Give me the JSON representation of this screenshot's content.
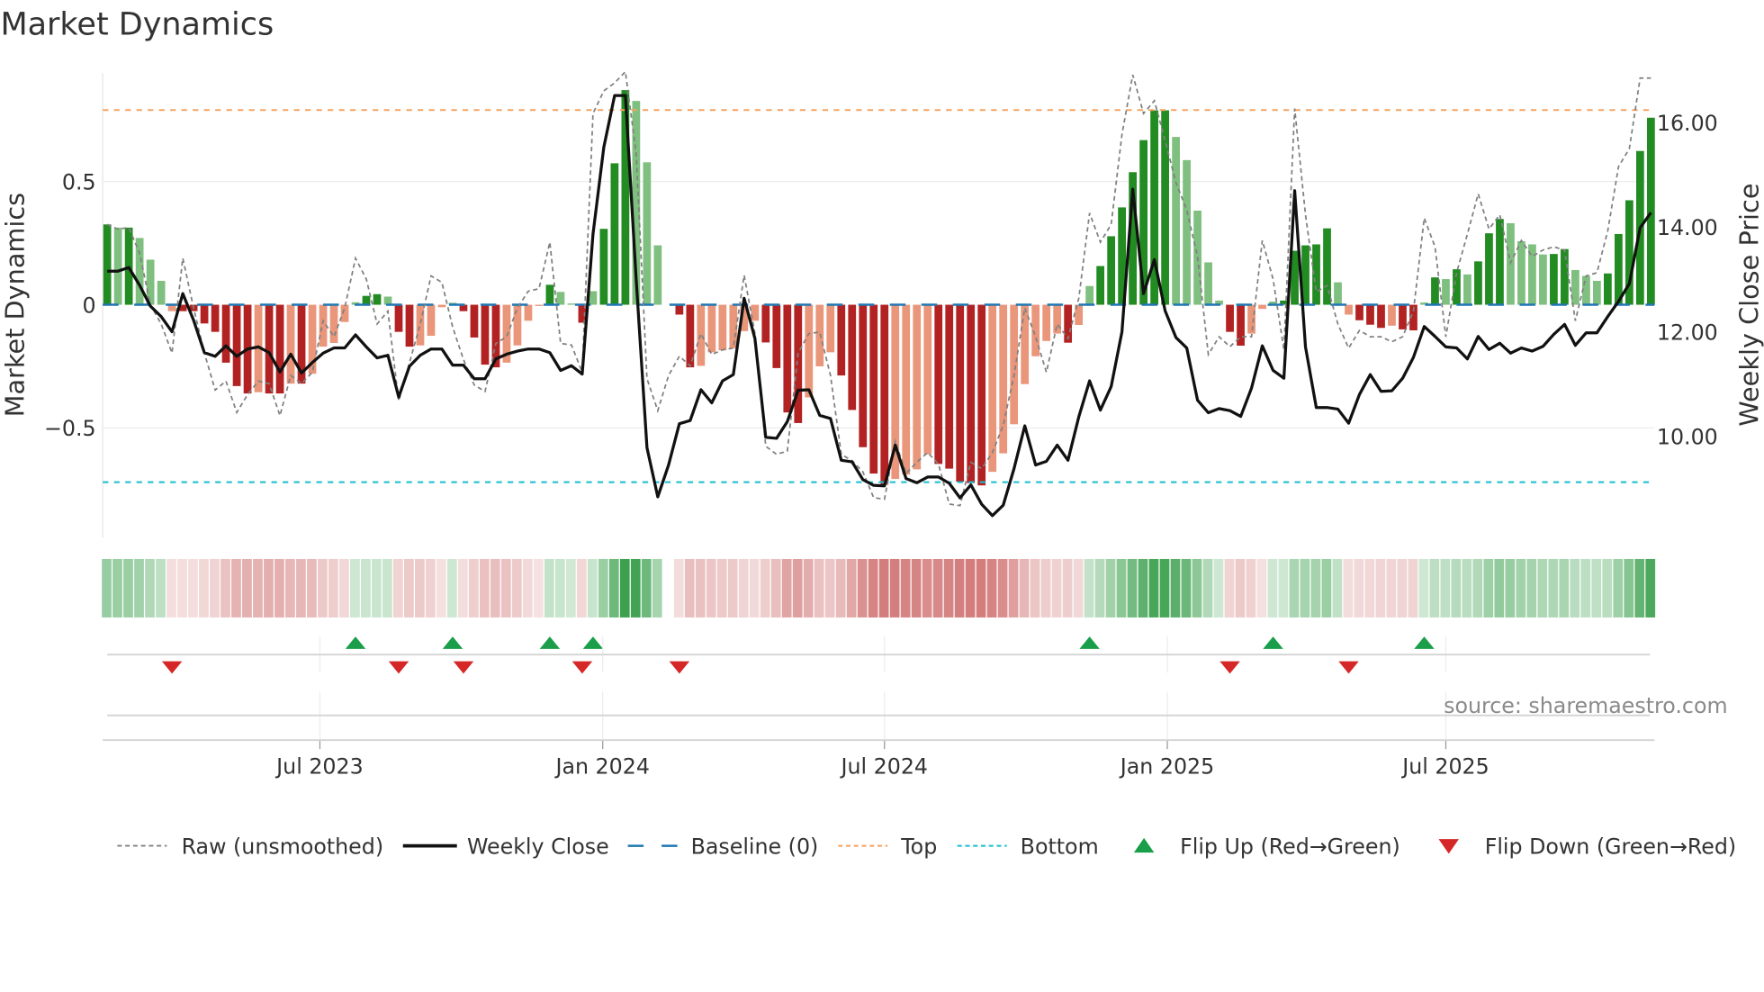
{
  "chart_data": {
    "type": "bar",
    "title": "Market Dynamics",
    "ylabel": "Market Dynamics",
    "y2label": "Weekly Close Price",
    "x_start": "2023-02-10",
    "x_frequency": "weekly",
    "ylim": [
      -0.945,
      0.94
    ],
    "y2lim": [
      8.06,
      16.95
    ],
    "yticks": [
      {
        "v": 0.5,
        "label": "0.5"
      },
      {
        "v": 0,
        "label": "0"
      },
      {
        "v": -0.5,
        "label": "−0.5"
      }
    ],
    "y2ticks": [
      {
        "v": 16,
        "label": "16.00"
      },
      {
        "v": 14,
        "label": "14.00"
      },
      {
        "v": 12,
        "label": "12.00"
      },
      {
        "v": 10,
        "label": "10.00"
      }
    ],
    "xticks": [
      {
        "week": 19.7,
        "label": "Jul 2023"
      },
      {
        "week": 45.9,
        "label": "Jan 2024"
      },
      {
        "week": 72,
        "label": "Jul 2024"
      },
      {
        "week": 98.2,
        "label": "Jan 2025"
      },
      {
        "week": 124,
        "label": "Jul 2025"
      }
    ],
    "top_level": 0.79,
    "bottom_level": -0.72,
    "baseline": 0,
    "momentum": [
      0.326,
      0.313,
      0.313,
      0.271,
      0.183,
      0.097,
      -0.026,
      -0.026,
      -0.026,
      -0.076,
      -0.11,
      -0.235,
      -0.33,
      -0.36,
      -0.355,
      -0.36,
      -0.36,
      -0.32,
      -0.32,
      -0.28,
      -0.17,
      -0.155,
      -0.07,
      0.01,
      0.036,
      0.043,
      0.033,
      -0.11,
      -0.17,
      -0.165,
      -0.126,
      -0.01,
      0.008,
      -0.026,
      -0.133,
      -0.243,
      -0.254,
      -0.235,
      -0.165,
      -0.065,
      -0.005,
      0.081,
      0.052,
      0.005,
      -0.073,
      0.055,
      0.308,
      0.574,
      0.871,
      0.827,
      0.578,
      0.241,
      null,
      -0.04,
      -0.254,
      -0.248,
      -0.193,
      -0.185,
      -0.176,
      -0.107,
      -0.065,
      -0.153,
      -0.257,
      -0.437,
      -0.48,
      -0.376,
      -0.25,
      -0.193,
      -0.287,
      -0.427,
      -0.578,
      -0.685,
      -0.73,
      -0.707,
      -0.689,
      -0.668,
      -0.607,
      -0.646,
      -0.665,
      -0.718,
      -0.724,
      -0.733,
      -0.678,
      -0.603,
      -0.485,
      -0.322,
      -0.209,
      -0.147,
      -0.117,
      -0.154,
      -0.082,
      0.076,
      0.157,
      0.278,
      0.395,
      0.538,
      0.668,
      0.789,
      0.789,
      0.681,
      0.587,
      0.382,
      0.172,
      0.017,
      -0.11,
      -0.166,
      -0.117,
      -0.017,
      0.013,
      0.017,
      0.219,
      0.241,
      0.245,
      0.31,
      0.091,
      -0.04,
      -0.063,
      -0.081,
      -0.094,
      -0.085,
      -0.1,
      -0.104,
      0.009,
      0.111,
      0.104,
      0.144,
      0.123,
      0.176,
      0.29,
      0.348,
      0.331,
      0.258,
      0.245,
      0.204,
      0.206,
      0.226,
      0.141,
      0.117,
      0.097,
      0.127,
      0.287,
      0.424,
      0.624,
      0.759
    ],
    "raw": [
      0.326,
      0.307,
      0.313,
      0.209,
      0.0,
      -0.078,
      -0.196,
      0.189,
      -0.013,
      -0.196,
      -0.346,
      -0.31,
      -0.437,
      -0.365,
      -0.31,
      -0.32,
      -0.45,
      -0.287,
      -0.32,
      -0.274,
      -0.065,
      -0.13,
      -0.013,
      0.189,
      0.104,
      -0.078,
      -0.026,
      -0.391,
      -0.235,
      -0.078,
      0.117,
      0.091,
      -0.091,
      -0.222,
      -0.326,
      -0.352,
      -0.157,
      -0.13,
      -0.013,
      0.055,
      0.065,
      0.254,
      -0.157,
      -0.163,
      -0.274,
      0.776,
      0.868,
      0.9,
      0.946,
      0.613,
      -0.3,
      -0.43,
      -0.287,
      -0.209,
      -0.248,
      -0.117,
      -0.202,
      -0.183,
      -0.176,
      0.12,
      -0.117,
      -0.574,
      -0.607,
      -0.594,
      -0.196,
      -0.117,
      -0.111,
      -0.287,
      -0.607,
      -0.633,
      -0.678,
      -0.783,
      -0.789,
      -0.554,
      -0.685,
      -0.639,
      -0.6,
      -0.646,
      -0.809,
      -0.815,
      -0.639,
      -0.665,
      -0.6,
      -0.489,
      -0.287,
      -0.013,
      -0.13,
      -0.274,
      -0.078,
      -0.137,
      0.026,
      0.372,
      0.254,
      0.326,
      0.691,
      0.933,
      0.776,
      0.828,
      0.665,
      0.496,
      0.385,
      0.196,
      -0.202,
      -0.13,
      -0.17,
      -0.13,
      -0.13,
      0.261,
      0.104,
      -0.183,
      0.796,
      0.365,
      0.052,
      0.078,
      -0.078,
      -0.176,
      -0.104,
      -0.13,
      -0.13,
      -0.15,
      -0.13,
      -0.026,
      0.352,
      0.235,
      -0.13,
      0.13,
      0.287,
      0.45,
      0.307,
      0.365,
      0.17,
      0.261,
      0.196,
      0.222,
      0.235,
      0.222,
      -0.065,
      0.117,
      0.13,
      0.3,
      0.561,
      0.633,
      0.92,
      0.92
    ],
    "weekly_close": [
      13.16,
      13.16,
      13.23,
      12.89,
      12.49,
      12.29,
      12.0,
      12.73,
      12.22,
      11.6,
      11.53,
      11.73,
      11.53,
      11.67,
      11.71,
      11.6,
      11.23,
      11.57,
      11.21,
      11.41,
      11.59,
      11.69,
      11.69,
      11.94,
      11.71,
      11.5,
      11.55,
      10.75,
      11.34,
      11.55,
      11.67,
      11.67,
      11.36,
      11.36,
      11.1,
      11.1,
      11.48,
      11.57,
      11.63,
      11.67,
      11.67,
      11.6,
      11.26,
      11.35,
      11.19,
      13.87,
      15.53,
      16.52,
      16.52,
      13.0,
      9.78,
      8.84,
      9.45,
      10.24,
      10.3,
      10.89,
      10.64,
      11.06,
      11.18,
      12.64,
      11.87,
      9.98,
      9.96,
      10.28,
      10.88,
      10.89,
      10.4,
      10.34,
      9.54,
      9.51,
      9.17,
      9.06,
      9.05,
      9.83,
      9.19,
      9.11,
      9.22,
      9.22,
      9.1,
      8.82,
      9.07,
      8.7,
      8.48,
      8.68,
      9.38,
      10.2,
      9.45,
      9.52,
      9.83,
      9.54,
      10.37,
      11.06,
      10.5,
      10.95,
      12.0,
      14.73,
      12.73,
      13.38,
      12.4,
      11.89,
      11.69,
      10.69,
      10.45,
      10.53,
      10.49,
      10.38,
      10.92,
      11.73,
      11.26,
      11.11,
      14.7,
      11.71,
      10.55,
      10.55,
      10.52,
      10.25,
      10.8,
      11.18,
      10.86,
      10.87,
      11.11,
      11.51,
      12.1,
      11.91,
      11.71,
      11.69,
      11.48,
      11.91,
      11.66,
      11.78,
      11.59,
      11.69,
      11.63,
      11.72,
      11.95,
      12.14,
      11.74,
      11.98,
      11.98,
      12.29,
      12.58,
      12.92,
      13.99,
      14.28
    ],
    "flip_up_weeks": [
      23,
      32,
      41,
      45,
      91,
      108,
      122
    ],
    "flip_down_weeks": [
      6,
      27,
      33,
      44,
      53,
      104,
      115
    ],
    "legend": {
      "position": "bottom",
      "items": [
        {
          "key": "raw",
          "label": "Raw (unsmoothed)"
        },
        {
          "key": "close",
          "label": "Weekly Close"
        },
        {
          "key": "baseline",
          "label": "Baseline (0)"
        },
        {
          "key": "top",
          "label": "Top"
        },
        {
          "key": "bottom",
          "label": "Bottom"
        },
        {
          "key": "flip_up",
          "label": "Flip Up (Red→Green)"
        },
        {
          "key": "flip_down",
          "label": "Flip Down (Green→Red)"
        }
      ]
    },
    "source": "source: sharemaestro.com",
    "colors": {
      "pos_strong": "#228b22",
      "pos_weak": "#7fbf7f",
      "neg_strong": "#b22222",
      "neg_weak": "#e9967a",
      "raw": "#808080",
      "close": "#111111",
      "baseline": "#1f77b4",
      "top": "#f4a460",
      "bottom": "#17becf",
      "flip_up": "#1a9e4a",
      "flip_down": "#d62728"
    }
  }
}
